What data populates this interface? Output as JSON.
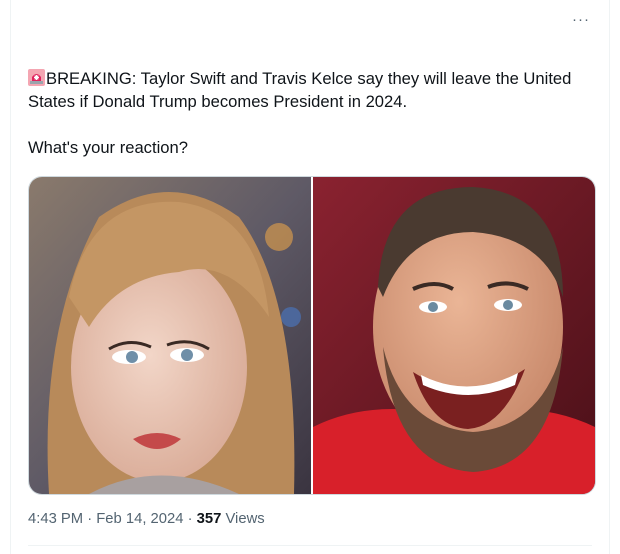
{
  "tweet": {
    "badge_icon": "rotating-light-icon",
    "headline": "BREAKING: Taylor Swift and Travis Kelce say they will leave the United States if Donald Trump becomes President in 2024.",
    "question": "What's your reaction?",
    "more_label": "···",
    "media_icons": [
      "woman-portrait-photo",
      "man-portrait-photo"
    ]
  },
  "meta": {
    "time": "4:43 PM",
    "separator1": " · ",
    "date": "Feb 14, 2024",
    "separator2": " · ",
    "views_count": "357",
    "views_label": " Views"
  },
  "colors": {
    "text": "#0f1419",
    "secondary": "#536471",
    "border": "#cfd9de",
    "siren": "#e0245e"
  }
}
